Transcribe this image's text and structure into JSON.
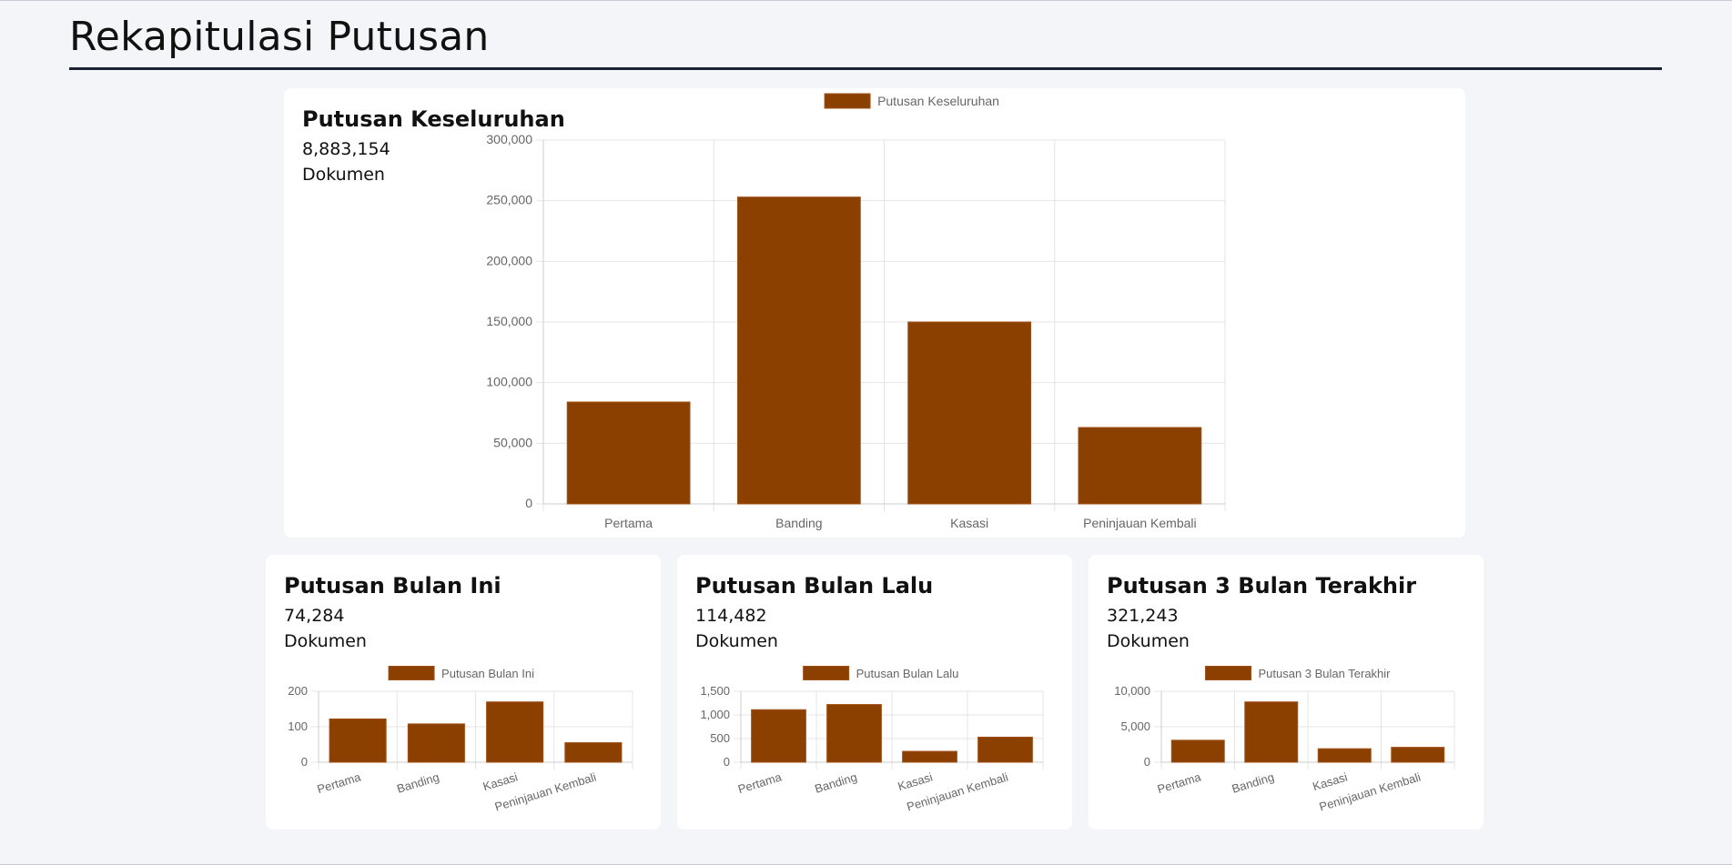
{
  "page": {
    "title": "Rekapitulasi Putusan"
  },
  "colors": {
    "bar_fill": "#8b4000",
    "bar_stroke": "#a0521a",
    "grid": "#e4e4e4",
    "axis": "#cccccc"
  },
  "cards": {
    "main": {
      "title": "Putusan Keseluruhan",
      "count": "8,883,154",
      "unit": "Dokumen"
    },
    "month": {
      "title": "Putusan Bulan Ini",
      "count": "74,284",
      "unit": "Dokumen"
    },
    "last": {
      "title": "Putusan Bulan Lalu",
      "count": "114,482",
      "unit": "Dokumen"
    },
    "three": {
      "title": "Putusan 3 Bulan Terakhir",
      "count": "321,243",
      "unit": "Dokumen"
    }
  },
  "chart_data": [
    {
      "type": "bar",
      "legend": "Putusan Keseluruhan",
      "categories": [
        "Pertama",
        "Banding",
        "Kasasi",
        "Peninjauan Kembali"
      ],
      "values": [
        84000,
        253000,
        150000,
        63000
      ],
      "ylim": [
        0,
        300000
      ],
      "yticks": [
        0,
        50000,
        100000,
        150000,
        200000,
        250000,
        300000
      ],
      "legend_position": "top",
      "grid": true
    },
    {
      "type": "bar",
      "legend": "Putusan Bulan Ini",
      "categories": [
        "Pertama",
        "Banding",
        "Kasasi",
        "Peninjauan Kembali"
      ],
      "values": [
        122,
        108,
        170,
        55
      ],
      "ylim": [
        0,
        200
      ],
      "yticks": [
        0,
        100,
        200
      ],
      "legend_position": "top",
      "grid": true
    },
    {
      "type": "bar",
      "legend": "Putusan Bulan Lalu",
      "categories": [
        "Pertama",
        "Banding",
        "Kasasi",
        "Peninjauan Kembali"
      ],
      "values": [
        1110,
        1220,
        230,
        530
      ],
      "ylim": [
        0,
        1500
      ],
      "yticks": [
        0,
        500,
        1000,
        1500
      ],
      "legend_position": "top",
      "grid": true
    },
    {
      "type": "bar",
      "legend": "Putusan 3 Bulan Terakhir",
      "categories": [
        "Pertama",
        "Banding",
        "Kasasi",
        "Peninjauan Kembali"
      ],
      "values": [
        3100,
        8500,
        1900,
        2100
      ],
      "ylim": [
        0,
        10000
      ],
      "yticks": [
        0,
        5000,
        10000
      ],
      "legend_position": "top",
      "grid": true
    }
  ]
}
